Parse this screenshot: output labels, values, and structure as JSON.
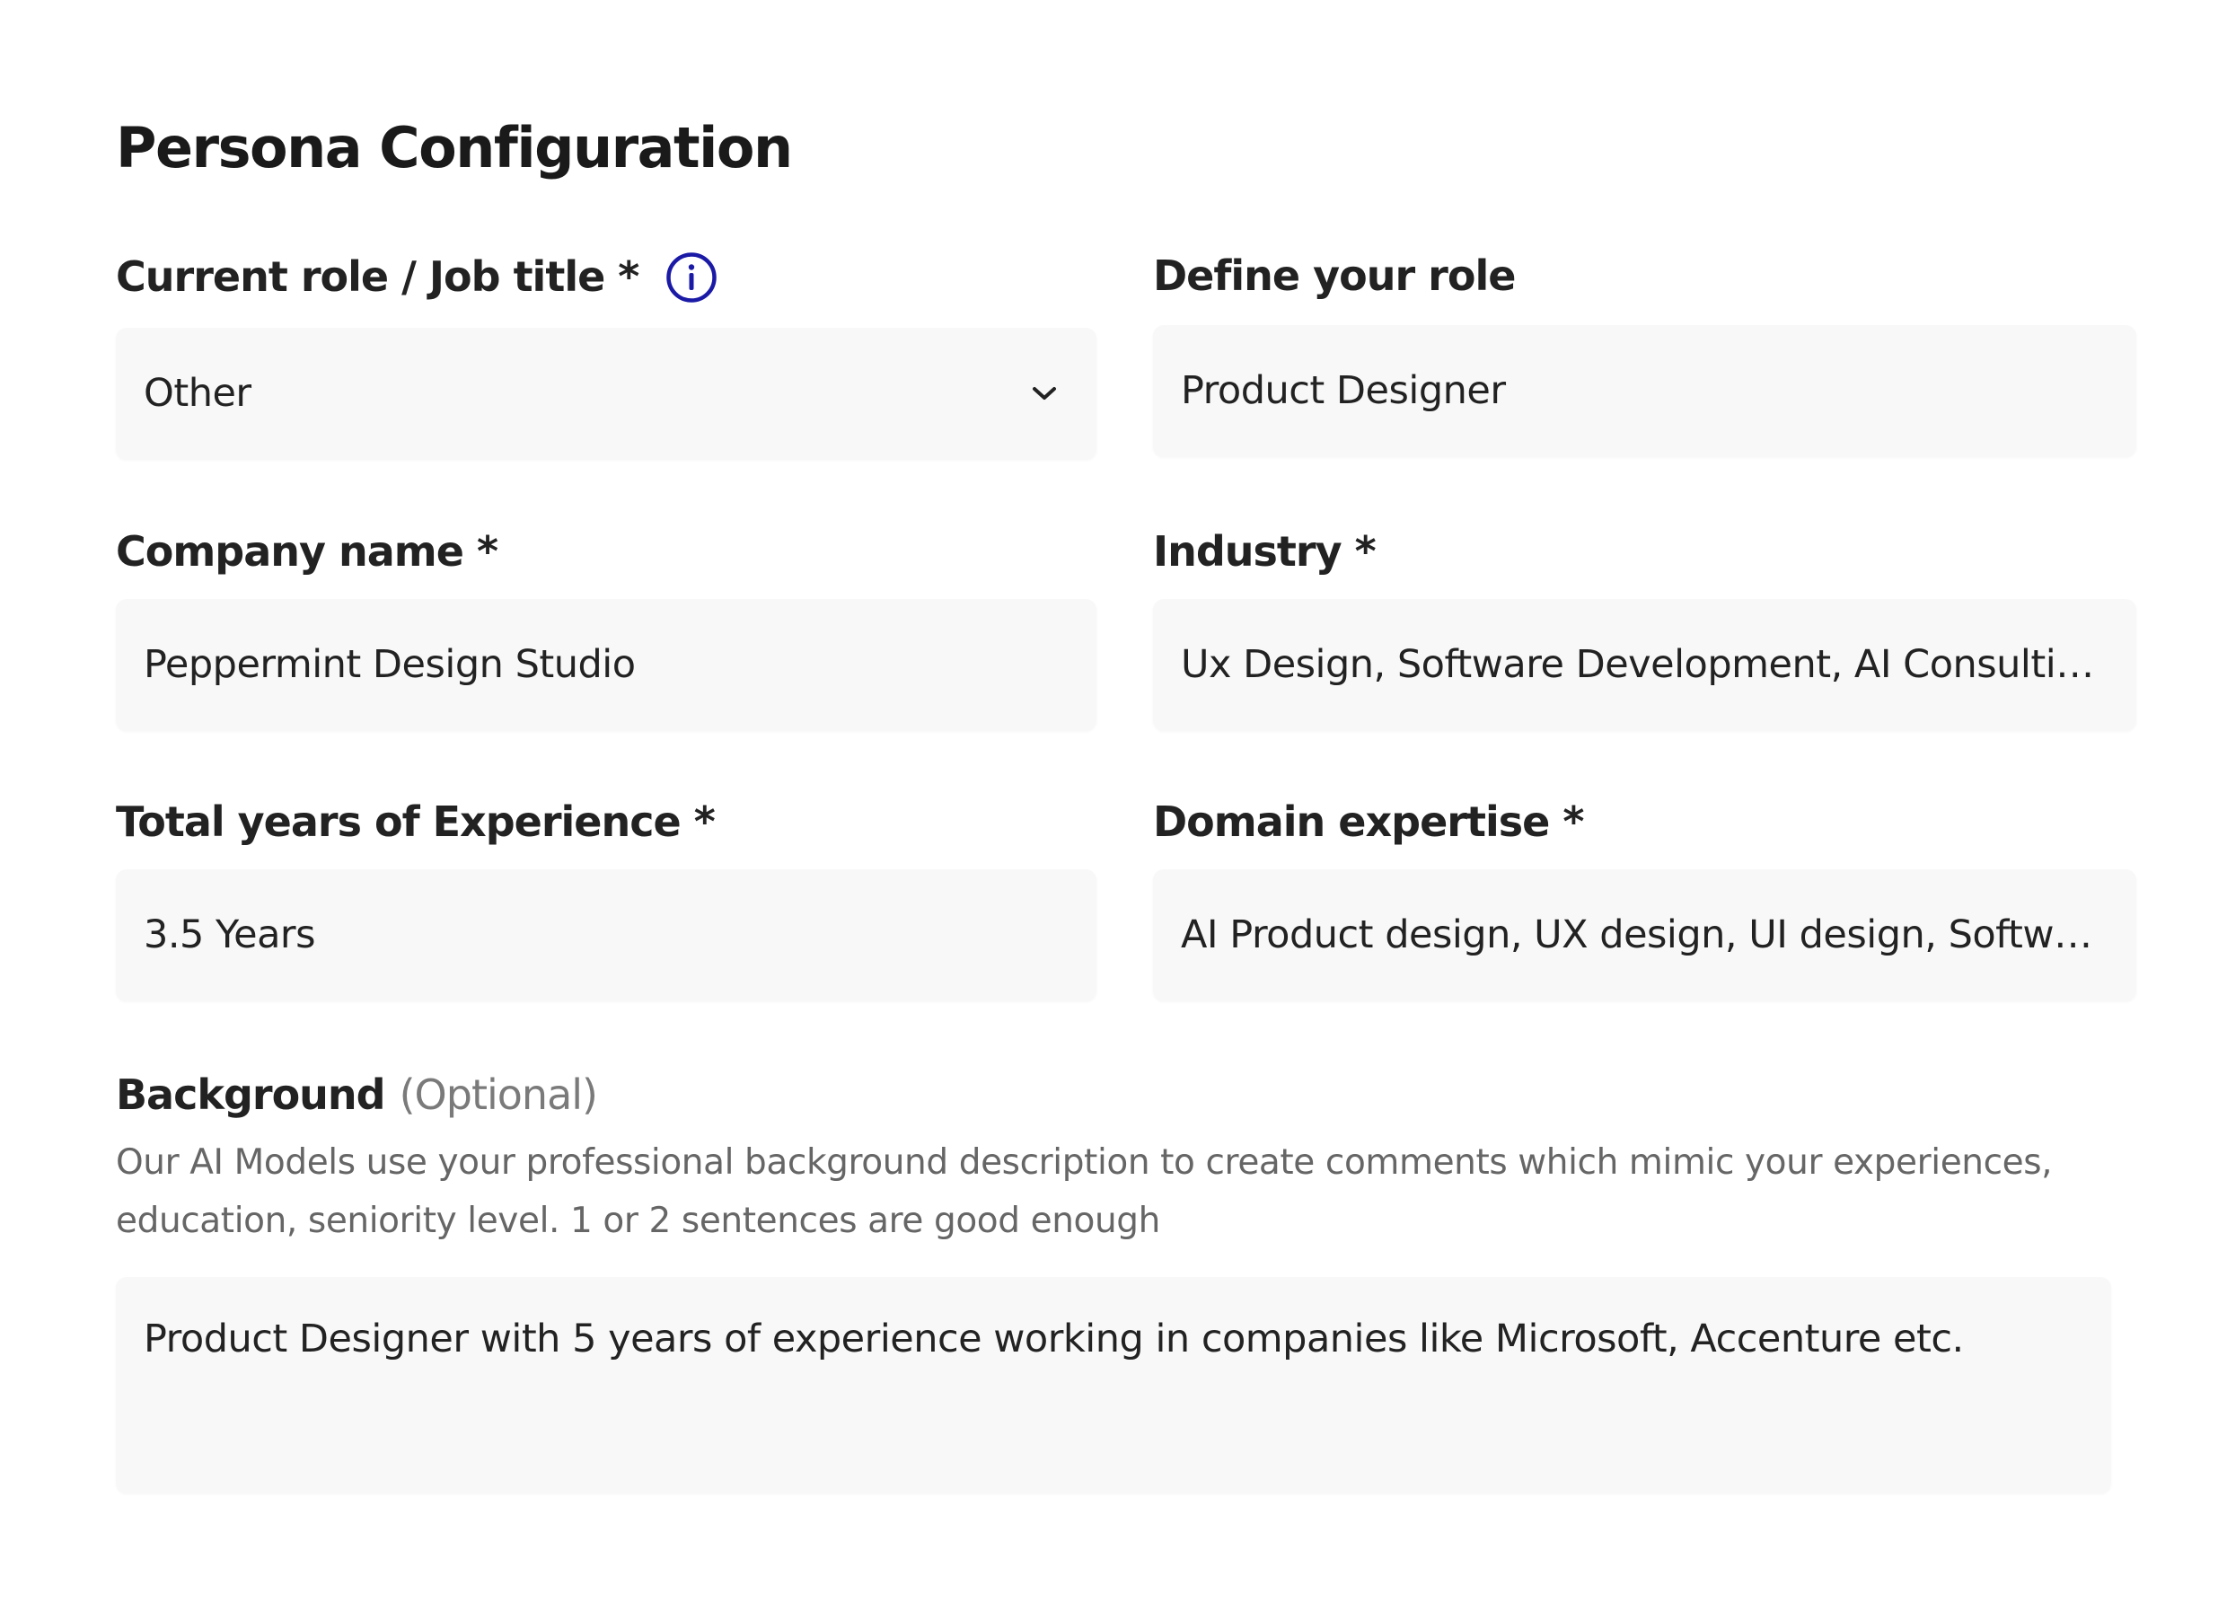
{
  "page": {
    "title": "Persona Configuration"
  },
  "form": {
    "role": {
      "label": "Current role / Job title *",
      "value": "Other",
      "icon": "info-icon",
      "chevron": "chevron-down-icon"
    },
    "define_role": {
      "label": "Define your role",
      "value": "Product Designer"
    },
    "company": {
      "label": "Company name *",
      "value": "Peppermint Design Studio"
    },
    "industry": {
      "label": "Industry *",
      "value": "Ux Design, Software Development, AI Consulting, Data Analytics"
    },
    "experience": {
      "label": "Total years of Experience *",
      "value": "3.5 Years"
    },
    "domain": {
      "label": "Domain expertise *",
      "value": "AI Product design, UX design, UI design, Software development"
    },
    "background": {
      "label": "Background",
      "optional": "(Optional)",
      "help": "Our AI Models use your professional background description to create comments which mimic your experiences, education, seniority level. 1 or 2 sentences are good enough",
      "value": "Product Designer with 5 years of experience working in companies like Microsoft, Accenture etc."
    }
  },
  "colors": {
    "accent": "#1a1aa6",
    "field_bg": "#f8f8f8",
    "label": "#222222",
    "muted": "#7a7a7a"
  }
}
